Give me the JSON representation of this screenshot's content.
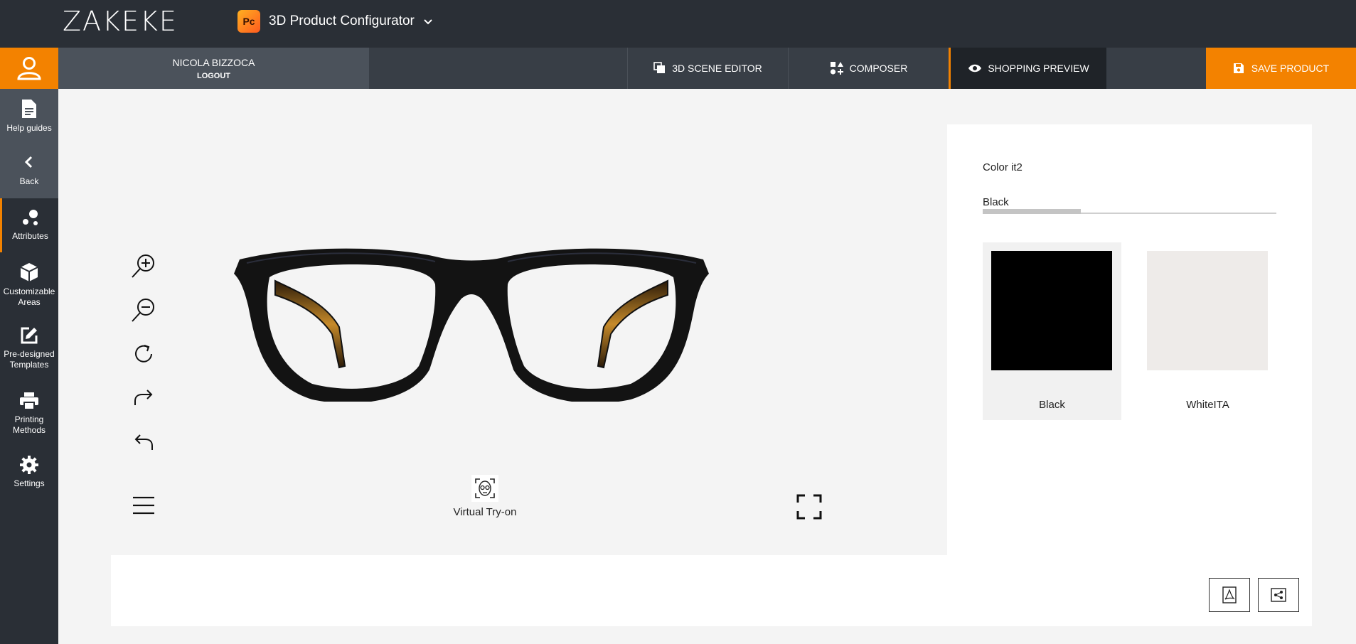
{
  "header": {
    "logo_text": "ZAKEKE",
    "app_badge": "Pc",
    "app_title": "3D Product Configurator"
  },
  "user": {
    "name": "NICOLA BIZZOCA",
    "logout_label": "LOGOUT"
  },
  "nav": {
    "scene_editor": "3D SCENE EDITOR",
    "composer": "COMPOSER",
    "shopping_preview": "SHOPPING PREVIEW",
    "save_product": "SAVE PRODUCT"
  },
  "sidebar": {
    "items": [
      {
        "label": "Help guides",
        "icon": "document-icon"
      },
      {
        "label": "Back",
        "icon": "chevron-left-icon"
      },
      {
        "label": "Attributes",
        "icon": "attributes-icon"
      },
      {
        "label": "Customizable Areas",
        "icon": "cube-icon"
      },
      {
        "label": "Pre-designed Templates",
        "icon": "edit-icon"
      },
      {
        "label": "Printing Methods",
        "icon": "printer-icon"
      },
      {
        "label": "Settings",
        "icon": "gear-icon"
      }
    ]
  },
  "viewer": {
    "virtual_tryon_label": "Virtual Try-on"
  },
  "panel": {
    "attribute_title": "Color it2",
    "active_tab": "Black",
    "options": [
      {
        "label": "Black",
        "color": "#000000",
        "selected": true
      },
      {
        "label": "WhiteITA",
        "color": "#eeebe9",
        "selected": false
      }
    ]
  },
  "colors": {
    "accent": "#f38200",
    "topbar": "#2a2f36"
  }
}
